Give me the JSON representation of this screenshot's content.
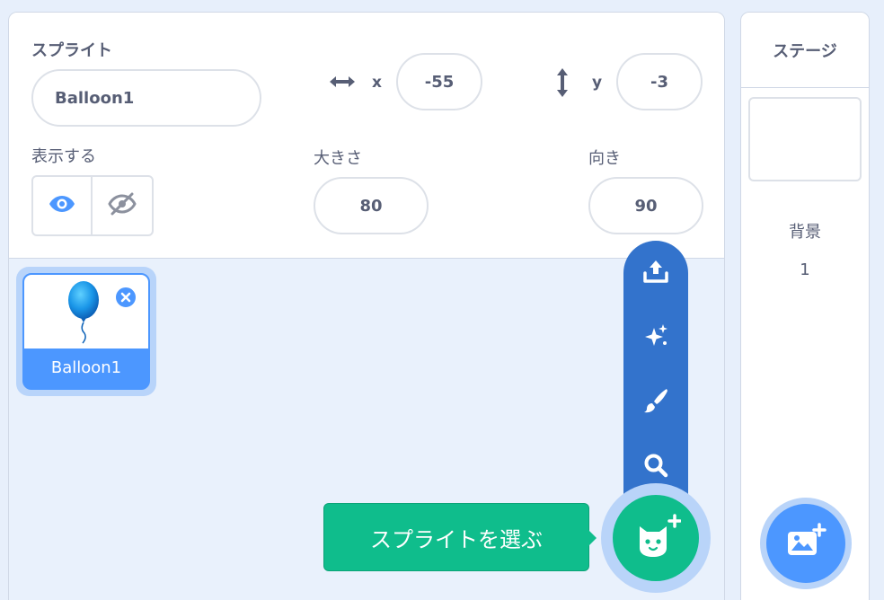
{
  "sprite_info": {
    "sprite_label": "スプライト",
    "sprite_name": "Balloon1",
    "x_label": "x",
    "x_value": "-55",
    "y_label": "y",
    "y_value": "-3",
    "show_label": "表示する",
    "size_label": "大きさ",
    "size_value": "80",
    "direction_label": "向き",
    "direction_value": "90"
  },
  "sprite_list": [
    {
      "name": "Balloon1",
      "selected": true
    }
  ],
  "add_sprite_menu": {
    "items": [
      "upload-icon",
      "surprise-sparkle-icon",
      "paint-brush-icon",
      "search-icon"
    ],
    "tooltip": "スプライトを選ぶ"
  },
  "stage": {
    "title": "ステージ",
    "backdrop_label": "背景",
    "backdrop_count": "1"
  },
  "colors": {
    "accent_blue": "#4c97ff",
    "menu_blue": "#3373cc",
    "fab_green": "#0fbd8c",
    "text": "#575e75"
  }
}
